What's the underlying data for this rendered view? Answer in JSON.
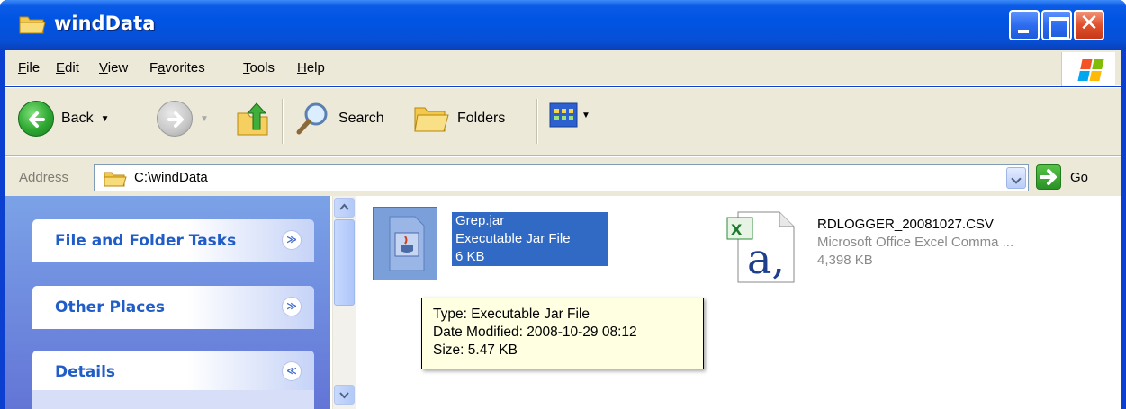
{
  "window": {
    "title": "windData",
    "close_glyph": "✕"
  },
  "menu": {
    "items": [
      {
        "key": "F",
        "rest": "ile"
      },
      {
        "key": "E",
        "rest": "dit"
      },
      {
        "key": "V",
        "rest": "iew"
      },
      {
        "pre": "F",
        "key": "a",
        "rest": "vorites"
      },
      {
        "key": "T",
        "rest": "ools"
      },
      {
        "key": "H",
        "rest": "elp"
      }
    ]
  },
  "toolbar": {
    "back_label": "Back",
    "search_label": "Search",
    "folders_label": "Folders"
  },
  "address": {
    "label": "Address",
    "value": "C:\\windData",
    "go_label": "Go"
  },
  "tasks": [
    {
      "title": "File and Folder Tasks",
      "chevron": "≫"
    },
    {
      "title": "Other Places",
      "chevron": "≫"
    },
    {
      "title": "Details",
      "chevron": "≪"
    }
  ],
  "files": [
    {
      "name": "Grep.jar",
      "type": "Executable Jar File",
      "size": "6 KB",
      "selected": true
    },
    {
      "name": "RDLOGGER_20081027.CSV",
      "type": "Microsoft Office Excel Comma ...",
      "size": "4,398 KB",
      "selected": false
    }
  ],
  "tooltip": {
    "type": "Type: Executable Jar File",
    "modified": "Date Modified: 2008-10-29 08:12",
    "size": "Size: 5.47 KB"
  }
}
